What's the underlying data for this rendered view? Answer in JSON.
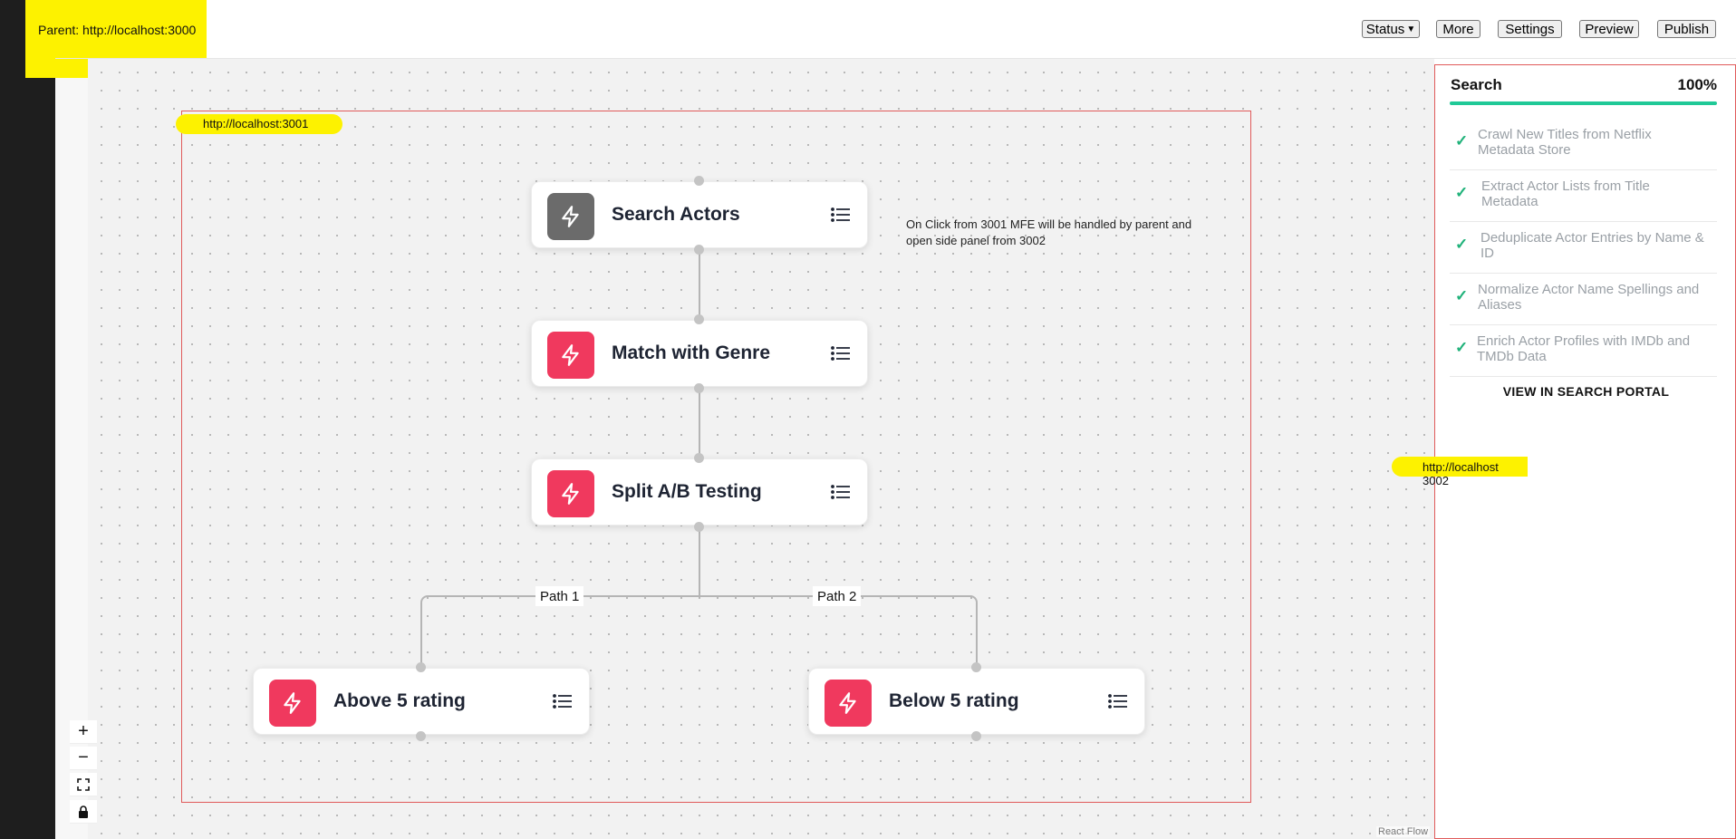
{
  "parent_label": "Parent: http://localhost:3000",
  "toolbar": {
    "status_label": "Status",
    "more_label": "More",
    "settings_label": "Settings",
    "preview_label": "Preview",
    "publish_label": "Publish"
  },
  "canvas": {
    "mfe_label": "http://localhost:3001",
    "annotation": "On Click from 3001  MFE will be handled by parent and open side panel from 3002",
    "attribution": "React Flow",
    "nodes": [
      {
        "title": "Search Actors",
        "icon": "bolt-icon",
        "color": "#6b6b6b"
      },
      {
        "title": "Match with Genre",
        "icon": "bolt-icon",
        "color": "#f0395e"
      },
      {
        "title": "Split A/B Testing",
        "icon": "bolt-icon",
        "color": "#f0395e"
      },
      {
        "title": "Above 5 rating",
        "icon": "bolt-icon",
        "color": "#f0395e"
      },
      {
        "title": "Below 5 rating",
        "icon": "bolt-icon",
        "color": "#f0395e"
      }
    ],
    "paths": [
      "Path 1",
      "Path 2"
    ],
    "controls": {
      "zoom_in": "+",
      "zoom_out": "−"
    }
  },
  "side_panel": {
    "title": "Search",
    "percent": "100%",
    "progress": 1.0,
    "accent_color": "#20c997",
    "tasks": [
      "Crawl New Titles from Netflix Metadata Store",
      "Extract Actor Lists from Title Metadata",
      "Deduplicate Actor Entries by Name & ID",
      "Normalize Actor Name Spellings and Aliases",
      "Enrich Actor Profiles with IMDb and TMDb Data"
    ],
    "check_mark": "✓",
    "view_link": "VIEW IN SEARCH PORTAL",
    "mfe_label": "http://localhost 3002"
  }
}
